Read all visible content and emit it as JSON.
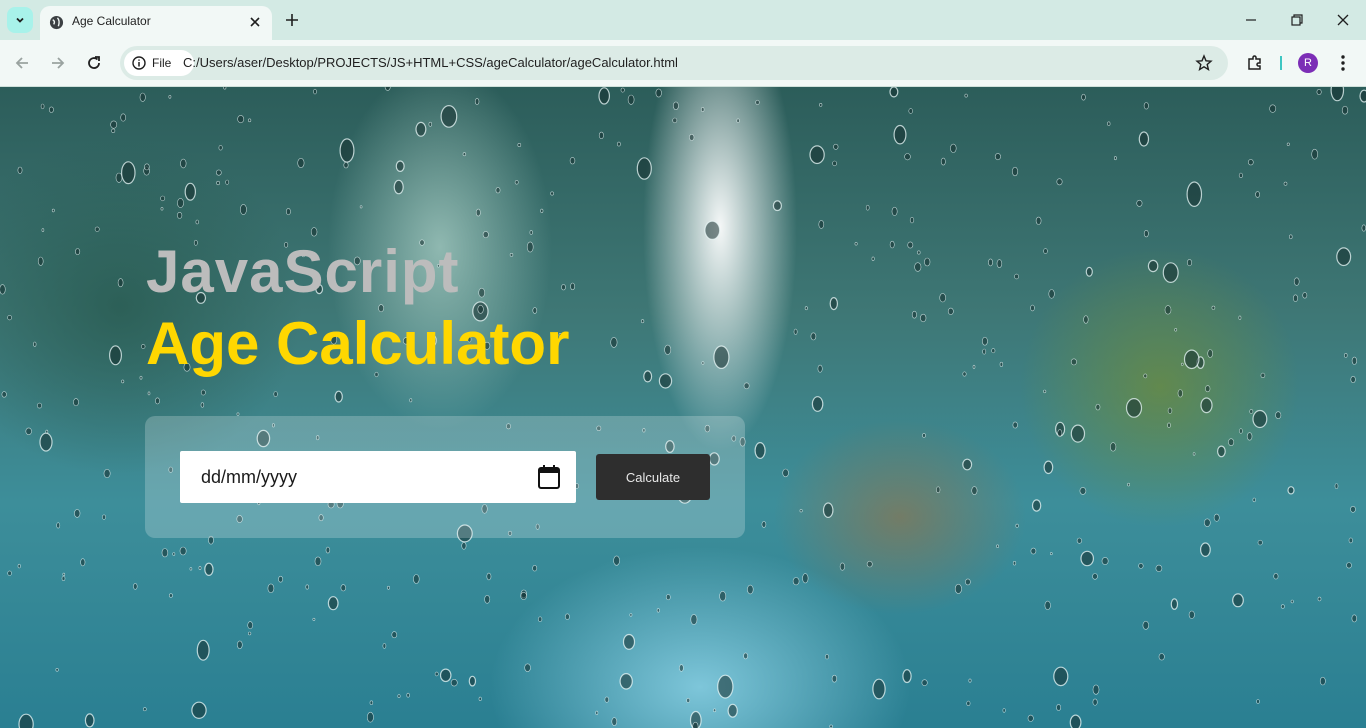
{
  "browser": {
    "tab": {
      "title": "Age Calculator",
      "favicon": "globe-icon"
    },
    "address": {
      "scheme_chip": "File",
      "url": "C:/Users/aser/Desktop/PROJECTS/JS+HTML+CSS/ageCalculator/ageCalculator.html"
    },
    "profile_initial": "R",
    "colors": {
      "tabbar": "#d3eae4",
      "toolbar": "#f2f8f6",
      "avatar": "#7c2eb6"
    }
  },
  "page": {
    "heading_line1": "JavaScript",
    "heading_line2": "Age Calculator",
    "date_input": {
      "placeholder": "dd/mm/yyyy",
      "icon": "calendar-icon"
    },
    "calculate_label": "Calculate",
    "colors": {
      "heading_line1": "#bcbcbc",
      "heading_line2": "#ffd700",
      "button": "#2e2e2e"
    }
  }
}
